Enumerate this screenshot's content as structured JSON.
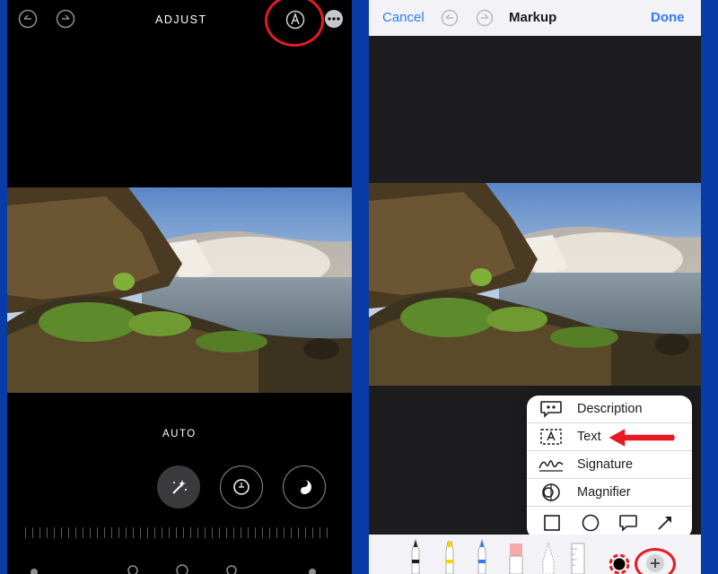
{
  "left": {
    "header_title": "ADJUST",
    "mode_label": "AUTO",
    "icons": [
      "undo-icon",
      "redo-icon",
      "markup-icon",
      "more-icon",
      "magic-wand-icon",
      "exposure-icon",
      "brilliance-icon"
    ]
  },
  "right": {
    "cancel_label": "Cancel",
    "title": "Markup",
    "done_label": "Done",
    "menu": {
      "items": [
        {
          "label": "Description",
          "icon": "description-icon"
        },
        {
          "label": "Text",
          "icon": "text-box-icon"
        },
        {
          "label": "Signature",
          "icon": "signature-icon"
        },
        {
          "label": "Magnifier",
          "icon": "magnifier-icon"
        }
      ],
      "shapes": [
        "square-icon",
        "circle-icon",
        "speech-bubble-icon",
        "arrow-icon"
      ]
    },
    "tools": [
      "pen-tool",
      "marker-tool",
      "pencil-tool",
      "eraser-tool",
      "lasso-tool",
      "ruler-tool",
      "color-picker",
      "add-button"
    ]
  },
  "colors": {
    "accent_blue": "#2f7bf5",
    "highlight_red": "#e41b23",
    "frame_blue": "#0a3ca8"
  }
}
